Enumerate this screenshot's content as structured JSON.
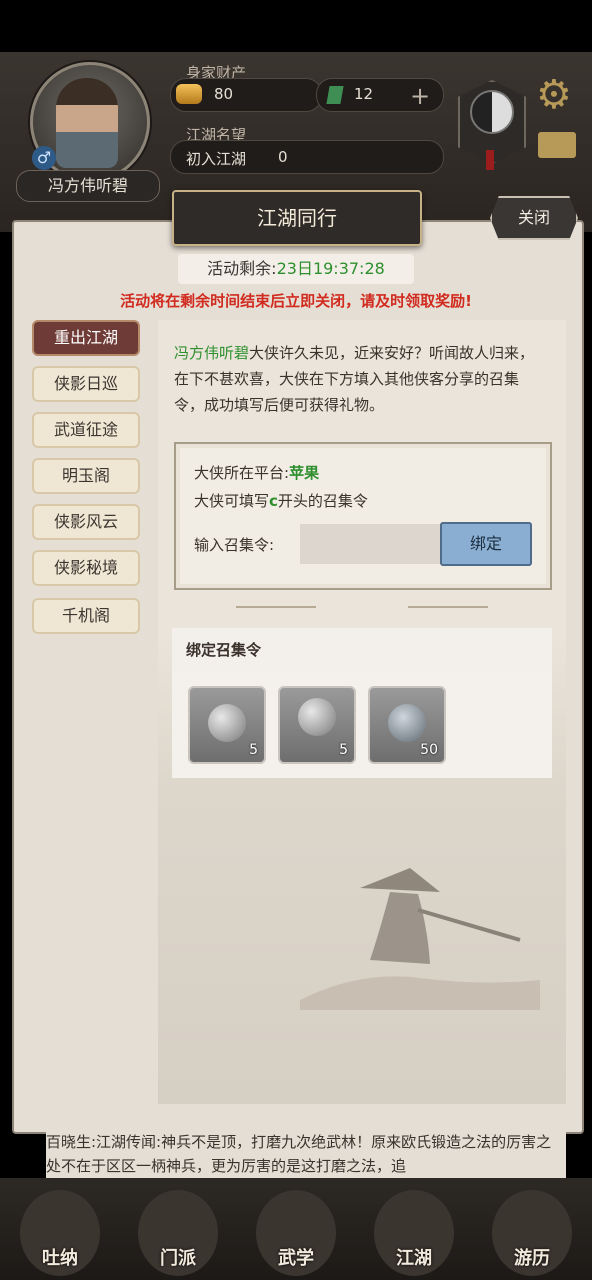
{
  "header": {
    "player_name": "冯方伟听碧",
    "gender_symbol": "♂",
    "wealth_label": "身家财产",
    "gold": "80",
    "jade": "12",
    "plus": "+",
    "reputation_label": "江湖名望",
    "reputation_title": "初入江湖",
    "reputation_value": "0",
    "gear_symbol": "⚙"
  },
  "modal": {
    "title": "江湖同行",
    "close_label": "关闭",
    "timer_label": "活动剩余:",
    "timer_value": "23日19:37:28",
    "warning": "活动将在剩余时间结束后立即关闭，请及时领取奖励!",
    "tabs": [
      "重出江湖",
      "侠影日巡",
      "武道征途",
      "明玉阁",
      "侠影风云",
      "侠影秘境",
      "千机阁"
    ],
    "active_tab": "重出江湖",
    "intro_name": "冯方伟听碧",
    "intro_text": "大侠许久未见，近来安好？听闻故人归来，在下不甚欢喜，大侠在下方填入其他侠客分享的召集令，成功填写后便可获得礼物。",
    "platform_label": "大侠所在平台:",
    "platform_value": "苹果",
    "code_hint_prefix": "大侠可填写",
    "code_hint_letter": "c",
    "code_hint_suffix": "开头的召集令",
    "input_label": "输入召集令:",
    "input_value": "",
    "bind_label": "绑定",
    "rewards_title": "绑定召集令",
    "rewards": [
      {
        "icon": "orb-icon",
        "qty": "5"
      },
      {
        "icon": "orb-stand-icon",
        "qty": "5"
      },
      {
        "icon": "crystal-orb-icon",
        "qty": "50"
      }
    ]
  },
  "bottom_text": "百晓生:江湖传闻:神兵不是顶，打磨九次绝武林！原来欧氏锻造之法的厉害之处不在于区区一柄神兵，更为厉害的是这打磨之法，追",
  "nav": [
    "吐纳",
    "门派",
    "武学",
    "江湖",
    "游历"
  ],
  "colors": {
    "accent_green": "#2f8f2f",
    "warning_red": "#d12b1f",
    "active_tab": "#6e3b36"
  }
}
